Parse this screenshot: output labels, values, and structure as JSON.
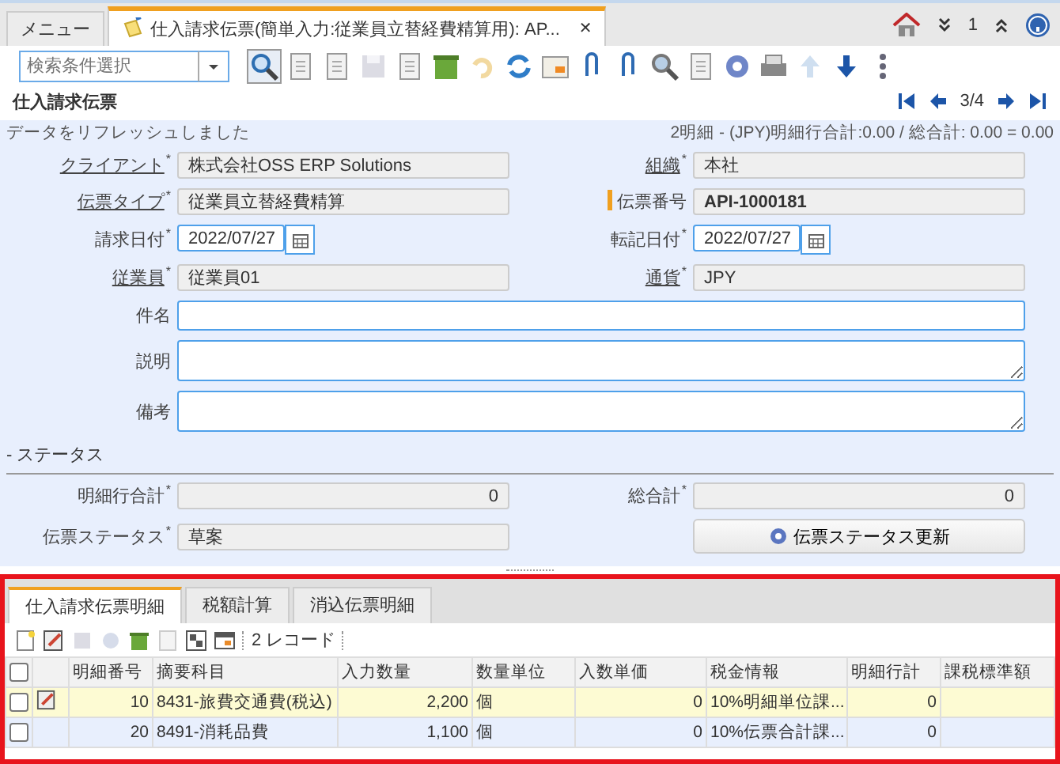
{
  "tabs": [
    {
      "label": "メニュー",
      "selected": false
    },
    {
      "label": "仕入請求伝票(簡単入力:従業員立替経費精算用): AP...",
      "selected": true,
      "close": "✕"
    }
  ],
  "notification_count": "1",
  "search": {
    "placeholder": "検索条件選択"
  },
  "title": "仕入請求伝票",
  "pager": "3/4",
  "message": "データをリフレッシュしました",
  "summary": "2明細 - (JPY)明細行合計:0.00 / 総合計: 0.00 = 0.00",
  "field_rows": [
    [
      {
        "label": "クライアント",
        "value": "株式会社OSS ERP Solutions",
        "required_mark": "*",
        "link": true,
        "kind": "readonly"
      },
      {
        "label": "組織",
        "value": "本社",
        "required_mark": "*",
        "link": true,
        "kind": "readonly"
      }
    ],
    [
      {
        "label": "伝票タイプ",
        "value": "従業員立替経費精算",
        "required_mark": "*",
        "link": true,
        "kind": "readonly"
      },
      {
        "label": "伝票番号",
        "value": "API-1000181",
        "link": false,
        "kind": "document-no"
      }
    ],
    [
      {
        "label": "請求日付",
        "value": "2022/07/27",
        "required_mark": "*",
        "link": false,
        "kind": "date"
      },
      {
        "label": "転記日付",
        "value": "2022/07/27",
        "required_mark": "*",
        "link": false,
        "kind": "date"
      }
    ],
    [
      {
        "label": "従業員",
        "value": "従業員01",
        "required_mark": "*",
        "link": true,
        "kind": "readonly"
      },
      {
        "label": "通貨",
        "value": "JPY",
        "required_mark": "*",
        "link": true,
        "kind": "readonly"
      }
    ]
  ],
  "wide_fields": [
    {
      "label": "件名",
      "kind": "input"
    },
    {
      "label": "説明",
      "kind": "textarea"
    },
    {
      "label": "備考",
      "kind": "textarea"
    }
  ],
  "status_section": "- ステータス",
  "status_rows": [
    [
      {
        "label": "明細行合計",
        "value": "0",
        "required_mark": "*",
        "link": false,
        "kind": "number"
      },
      {
        "label": "総合計",
        "value": "0",
        "required_mark": "*",
        "link": false,
        "kind": "number"
      }
    ],
    [
      {
        "label": "伝票ステータス",
        "value": "草案",
        "required_mark": "*",
        "link": false,
        "kind": "readonly"
      }
    ]
  ],
  "status_button": "伝票ステータス更新",
  "detail_tabs": [
    {
      "label": "仕入請求伝票明細",
      "selected": true
    },
    {
      "label": "税額計算",
      "selected": false
    },
    {
      "label": "消込伝票明細",
      "selected": false
    }
  ],
  "record_count": "2 レコード",
  "table": {
    "all_checked": false,
    "columns": [
      "明細番号",
      "摘要科目",
      "入力数量",
      "数量単位",
      "入数単価",
      "税金情報",
      "明細行計",
      "課税標準額"
    ],
    "rows": [
      {
        "checked": false,
        "current": true,
        "cells": [
          "10",
          "8431-旅費交通費(税込)",
          "2,200",
          "個",
          "0",
          "10%明細単位課...",
          "0"
        ]
      },
      {
        "checked": false,
        "current": false,
        "cells": [
          "20",
          "8491-消耗品費",
          "1,100",
          "個",
          "0",
          "10%伝票合計課...",
          "0"
        ]
      }
    ]
  }
}
